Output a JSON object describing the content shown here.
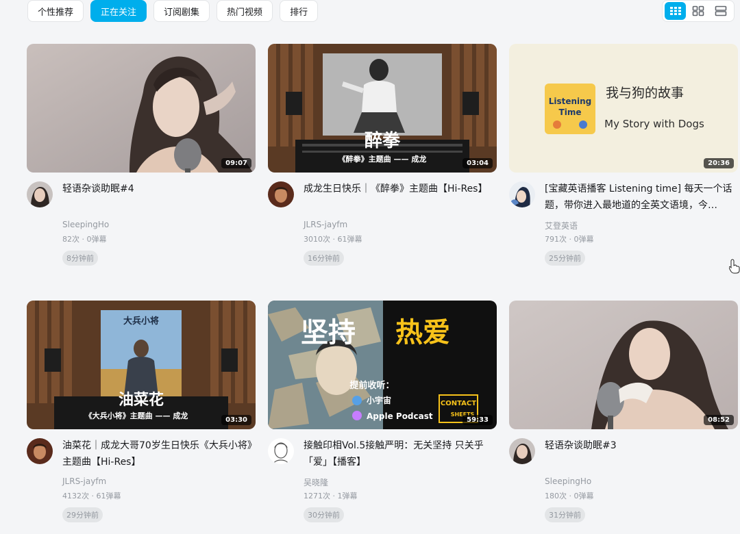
{
  "tabs": [
    {
      "label": "个性推荐",
      "active": false
    },
    {
      "label": "正在关注",
      "active": true
    },
    {
      "label": "订阅剧集",
      "active": false
    },
    {
      "label": "热门视频",
      "active": false
    },
    {
      "label": "排行",
      "active": false
    }
  ],
  "view_modes": [
    "grid-large-icon",
    "grid-small-icon",
    "list-icon"
  ],
  "accent_color": "#00aeec",
  "videos": [
    {
      "title": "轻语杂谈助眠#4",
      "uploader": "SleepingHo",
      "stats": "82次 · 0弹幕",
      "ago": "8分钟前",
      "duration": "09:07"
    },
    {
      "title": "成龙生日快乐｜《醉拳》主题曲【Hi-Res】",
      "uploader": "JLRS-jayfm",
      "stats": "3010次 · 61弹幕",
      "ago": "16分钟前",
      "duration": "03:04",
      "thumb_caption_big": "醉拳",
      "thumb_caption_small": "《醉拳》主题曲 —— 成龙"
    },
    {
      "title": "[宝藏英语播客 Listening time] 每天一个话题，带你进入最地道的全英文语境，今…",
      "uploader": "艾登英语",
      "stats": "791次 · 0弹幕",
      "ago": "25分钟前",
      "duration": "20:36",
      "thumb_cn": "我与狗的故事",
      "thumb_en": "My Story with Dogs",
      "thumb_logo_top": "Listening",
      "thumb_logo_bottom": "Time"
    },
    {
      "title": "油菜花｜成龙大哥70岁生日快乐《大兵小将》主题曲【Hi-Res】",
      "uploader": "JLRS-jayfm",
      "stats": "4132次 · 61弹幕",
      "ago": "29分钟前",
      "duration": "03:30",
      "thumb_caption_big": "油菜花",
      "thumb_caption_small": "《大兵小将》主题曲 —— 成龙",
      "thumb_poster_title": "大兵小将"
    },
    {
      "title": "接触印相Vol.5接触严明：无关坚持 只关乎「爱」【播客】",
      "uploader": "吴晓隆",
      "stats": "1271次 · 1弹幕",
      "ago": "30分钟前",
      "duration": "59:33",
      "thumb_word1": "坚持",
      "thumb_word2": "热爱",
      "thumb_listen": "提前收听：",
      "thumb_app1": "小宇宙",
      "thumb_app2": "Apple Podcast",
      "thumb_brand1": "CONTACT",
      "thumb_brand2": "SHEETS"
    },
    {
      "title": "轻语杂谈助眠#3",
      "uploader": "SleepingHo",
      "stats": "180次 · 0弹幕",
      "ago": "31分钟前",
      "duration": "08:52"
    }
  ]
}
